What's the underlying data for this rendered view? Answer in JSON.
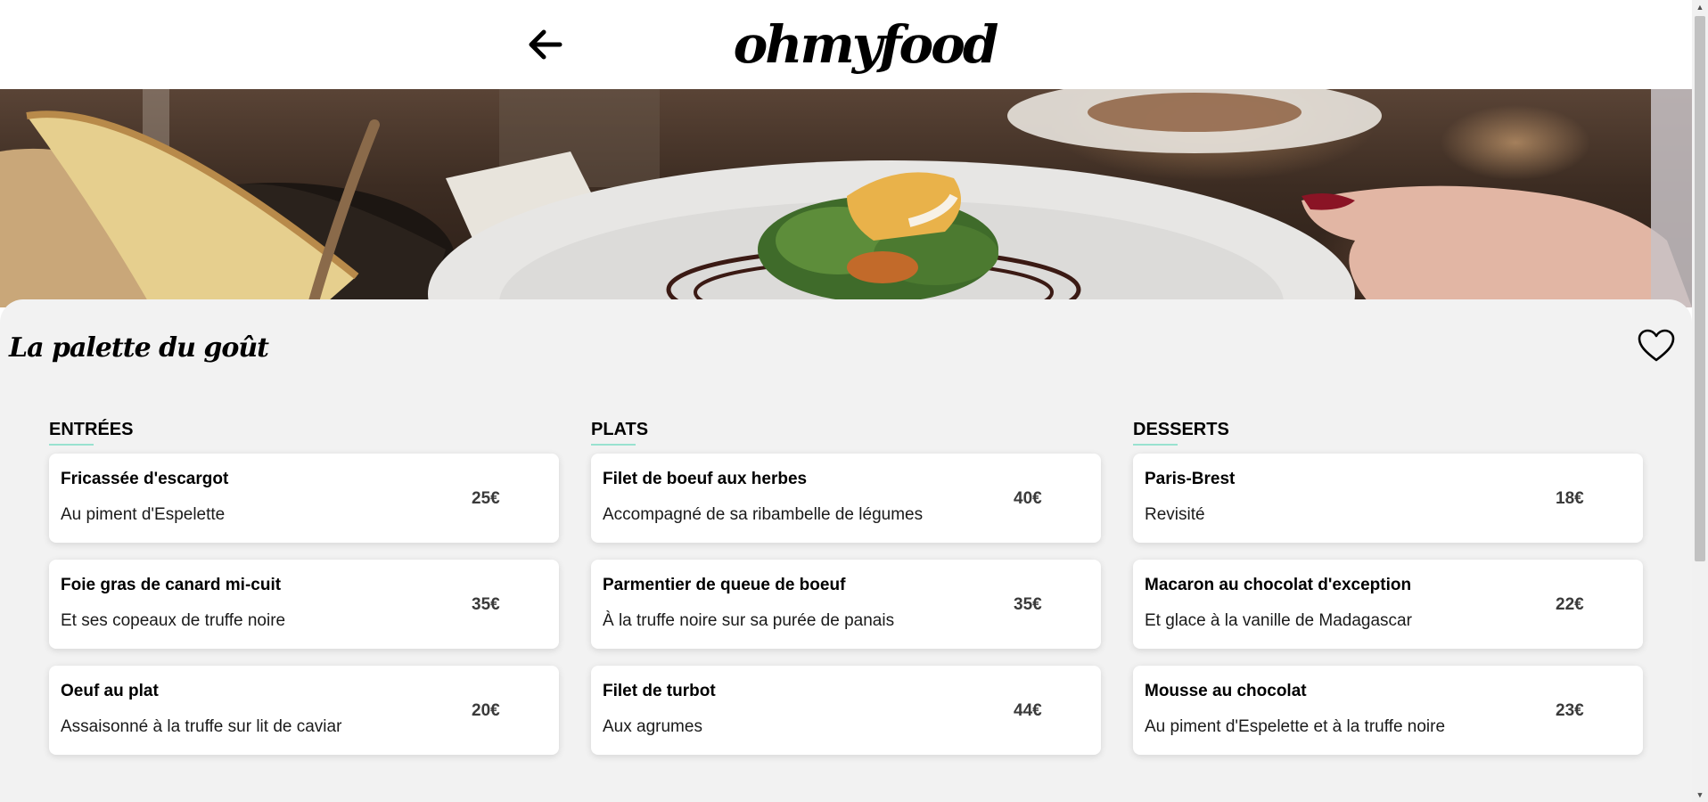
{
  "header": {
    "logo": "ohmyfood"
  },
  "restaurant": {
    "name": "La palette du goût"
  },
  "menu": [
    {
      "title": "ENTRÉES",
      "dishes": [
        {
          "name": "Fricassée d'escargot",
          "desc": "Au piment d'Espelette",
          "price": "25€"
        },
        {
          "name": "Foie gras de canard mi-cuit",
          "desc": "Et ses copeaux de truffe noire",
          "price": "35€"
        },
        {
          "name": "Oeuf au plat",
          "desc": "Assaisonné à la truffe sur lit de caviar",
          "price": "20€"
        }
      ]
    },
    {
      "title": "PLATS",
      "dishes": [
        {
          "name": "Filet de boeuf aux herbes",
          "desc": "Accompagné de sa ribambelle de légumes",
          "price": "40€"
        },
        {
          "name": "Parmentier de queue de boeuf",
          "desc": "À la truffe noire sur sa purée de panais",
          "price": "35€"
        },
        {
          "name": "Filet de turbot",
          "desc": "Aux agrumes",
          "price": "44€"
        }
      ]
    },
    {
      "title": "DESSERTS",
      "dishes": [
        {
          "name": "Paris-Brest",
          "desc": "Revisité",
          "price": "18€"
        },
        {
          "name": "Macaron au chocolat d'exception",
          "desc": "Et glace à la vanille de Madagascar",
          "price": "22€"
        },
        {
          "name": "Mousse au chocolat",
          "desc": "Au piment d'Espelette et à la truffe noire",
          "price": "23€"
        }
      ]
    }
  ],
  "icons": {
    "back": "arrow-left-icon",
    "favorite": "heart-icon"
  },
  "colors": {
    "accent_underline": "#99e2d0",
    "panel_background": "#f2f2f2",
    "card_background": "#ffffff"
  }
}
